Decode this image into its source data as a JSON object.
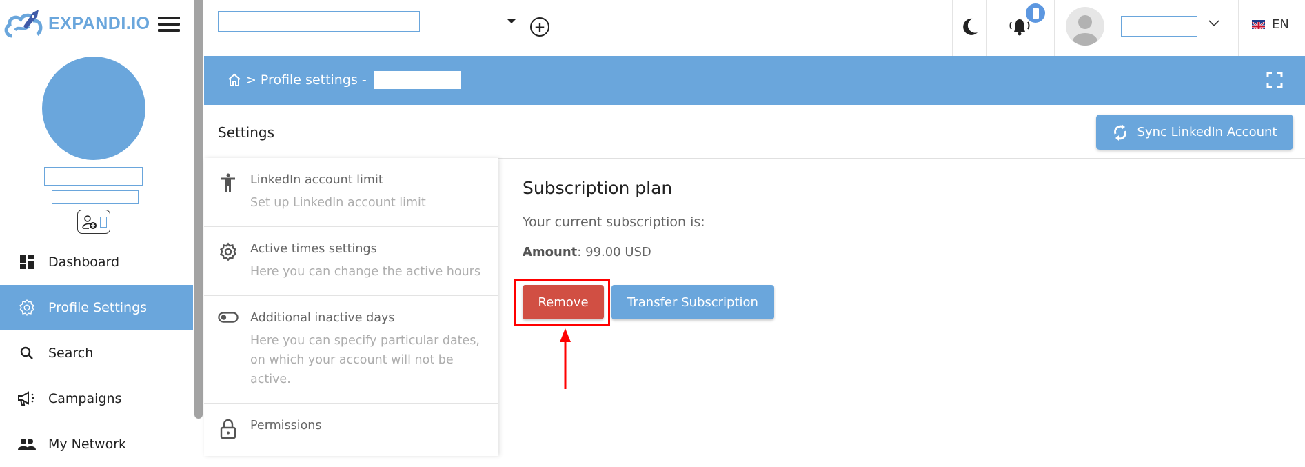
{
  "brand": {
    "name": "EXPANDI.IO",
    "accent": "#6aa6dc",
    "logo_rocket_color": "#3f5aa8"
  },
  "topbar": {
    "account_select_value": "",
    "add_account_icon": "plus-circle-icon",
    "theme_icon": "moon-icon",
    "notifications_icon": "bell-icon",
    "notification_badge": "",
    "user_name": "",
    "language": "EN"
  },
  "sidebar": {
    "user_name": "",
    "user_subtitle": "",
    "items": [
      {
        "label": "Dashboard",
        "icon": "dashboard-icon",
        "active": false
      },
      {
        "label": "Profile Settings",
        "icon": "gear-icon",
        "active": true
      },
      {
        "label": "Search",
        "icon": "search-icon",
        "active": false
      },
      {
        "label": "Campaigns",
        "icon": "megaphone-icon",
        "active": false
      },
      {
        "label": "My Network",
        "icon": "people-icon",
        "active": false
      }
    ]
  },
  "breadcrumb": {
    "home_icon": "home-icon",
    "separator": ">",
    "current": "Profile settings -",
    "profile_name": ""
  },
  "page": {
    "title": "Settings",
    "sync_button": "Sync LinkedIn Account"
  },
  "settings_menu": [
    {
      "title": "LinkedIn account limit",
      "description": "Set up LinkedIn account limit",
      "icon": "accessibility-icon"
    },
    {
      "title": "Active times settings",
      "description": "Here you can change the active hours",
      "icon": "gear-icon"
    },
    {
      "title": "Additional inactive days",
      "description": "Here you can specify particular dates, on which your account will not be active.",
      "icon": "toggle-icon"
    },
    {
      "title": "Permissions",
      "description": "",
      "icon": "lock-icon"
    }
  ],
  "subscription": {
    "title": "Subscription plan",
    "current_label": "Your current subscription is:",
    "amount_label": "Amount",
    "amount_value": ": 99.00 USD",
    "remove_button": "Remove",
    "transfer_button": "Transfer Subscription",
    "remove_color": "#d14f43"
  },
  "annotation": {
    "highlight_color": "#ff0000",
    "target": "Remove"
  }
}
